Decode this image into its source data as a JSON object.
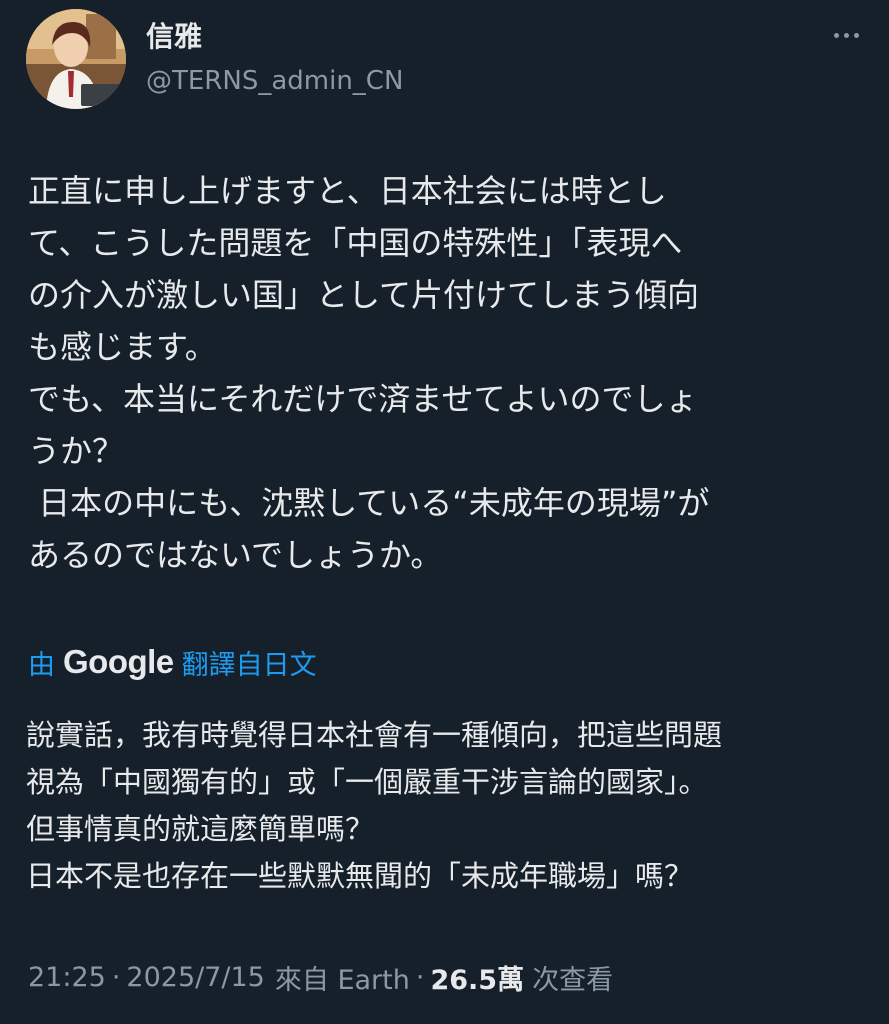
{
  "author": {
    "display_name": "信雅",
    "handle": "@TERNS_admin_CN",
    "avatar_icon": "user-avatar"
  },
  "more_icon": "more-options-icon",
  "tweet": {
    "text": "正直に申し上げますと、日本社会には時とし\nて、こうした問題を「中国の特殊性」「表現へ\nの介入が激しい国」として片付けてしまう傾向\nも感じます。\nでも、本当にそれだけで済ませてよいのでしょ\nうか？\n 日本の中にも、沈黙している“未成年の現場”が\nあるのではないでしょうか。"
  },
  "translation": {
    "prefix": "由",
    "provider": "Google",
    "suffix": "翻譯自日文",
    "text": "說實話，我有時覺得日本社會有一種傾向，把這些問題\n視為「中國獨有的」或「一個嚴重干涉言論的國家」。\n但事情真的就這麼簡單嗎？\n日本不是也存在一些默默無聞的「未成年職場」嗎？"
  },
  "meta": {
    "time": "21:25",
    "separator": "·",
    "date": "2025/7/15",
    "source": "來自 Earth",
    "views_count": "26.5萬",
    "views_label": "次查看"
  },
  "colors": {
    "background": "#15202b",
    "text_primary": "#e7e9ea",
    "text_secondary": "#8b98a5",
    "link": "#1d9bf0"
  }
}
